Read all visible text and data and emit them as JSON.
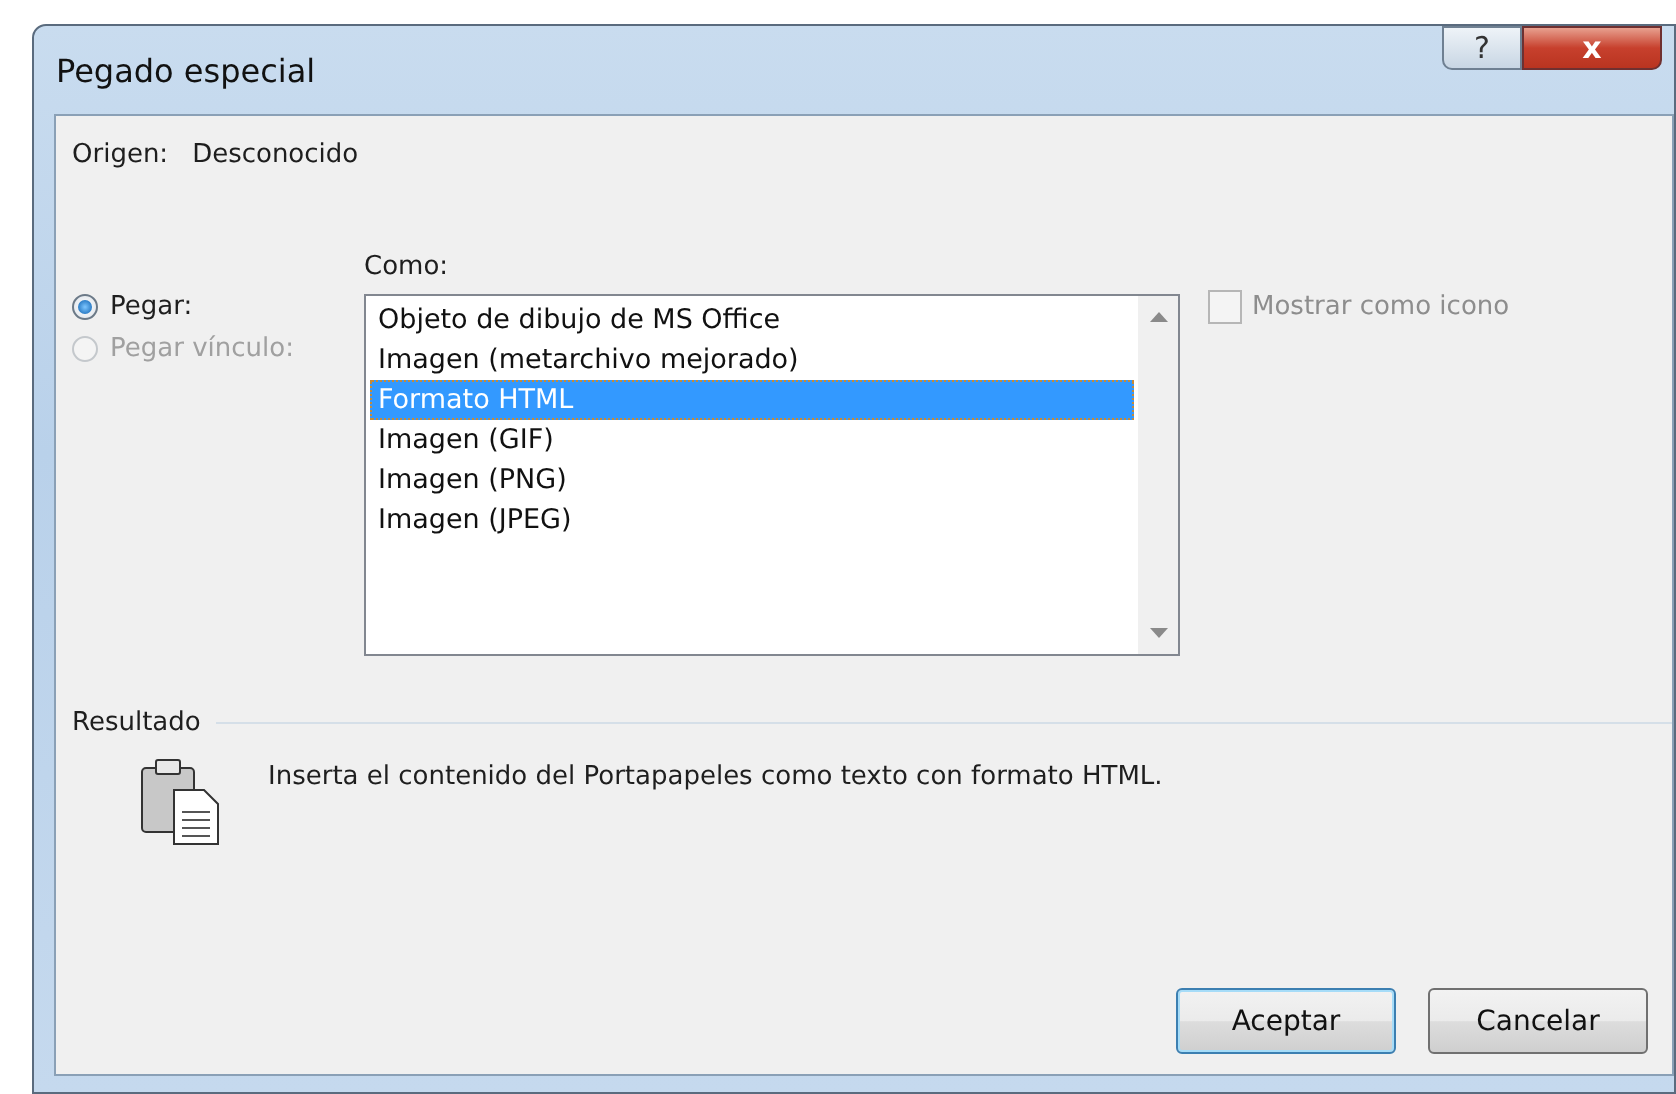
{
  "window": {
    "title": "Pegado especial",
    "help_button": "?",
    "close_button": "x"
  },
  "source": {
    "label": "Origen:",
    "value": "Desconocido"
  },
  "paste_options": [
    {
      "label": "Pegar:",
      "selected": true,
      "disabled": false
    },
    {
      "label": "Pegar vínculo:",
      "selected": false,
      "disabled": true
    }
  ],
  "as_list": {
    "label": "Como:",
    "items": [
      {
        "label": "Objeto de dibujo de MS Office",
        "selected": false
      },
      {
        "label": "Imagen (metarchivo mejorado)",
        "selected": false
      },
      {
        "label": "Formato HTML",
        "selected": true
      },
      {
        "label": "Imagen (GIF)",
        "selected": false
      },
      {
        "label": "Imagen (PNG)",
        "selected": false
      },
      {
        "label": "Imagen (JPEG)",
        "selected": false
      }
    ]
  },
  "display_as_icon": {
    "label": "Mostrar como icono",
    "checked": false,
    "disabled": true
  },
  "result": {
    "heading": "Resultado",
    "text": "Inserta el contenido del Portapapeles como texto con formato HTML."
  },
  "buttons": [
    {
      "label": "Aceptar",
      "default": true
    },
    {
      "label": "Cancelar",
      "default": false
    }
  ]
}
